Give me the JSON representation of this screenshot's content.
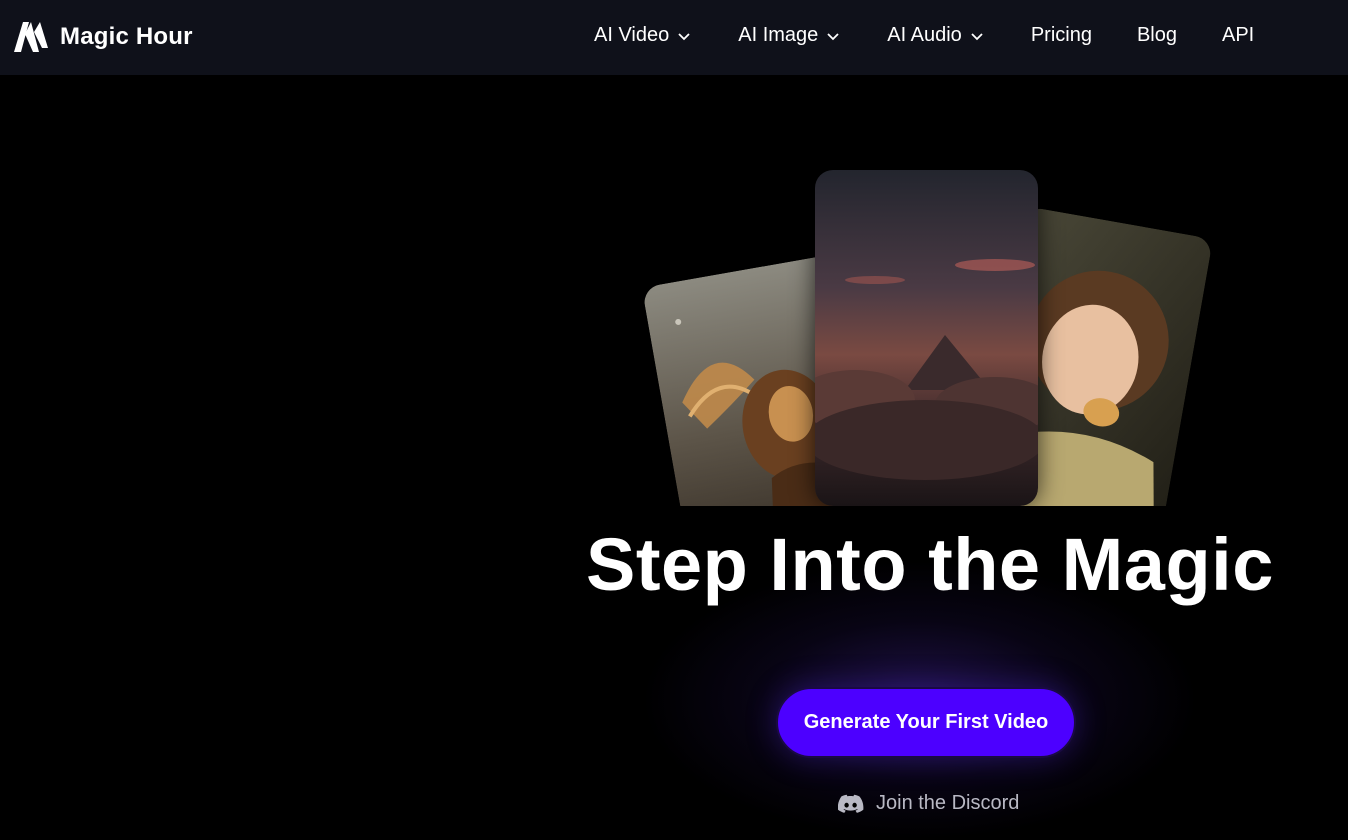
{
  "brand": {
    "name": "Magic Hour",
    "logo_icon": "magic-hour-logo-icon"
  },
  "nav": {
    "items": [
      {
        "label": "AI Video",
        "has_dropdown": true
      },
      {
        "label": "AI Image",
        "has_dropdown": true
      },
      {
        "label": "AI Audio",
        "has_dropdown": true
      },
      {
        "label": "Pricing",
        "has_dropdown": false
      },
      {
        "label": "Blog",
        "has_dropdown": false
      },
      {
        "label": "API",
        "has_dropdown": false
      }
    ]
  },
  "hero": {
    "headline": "Step Into the Magic",
    "cta_label": "Generate Your First Video",
    "discord_label": "Join the Discord",
    "discord_icon": "discord-icon",
    "cards": [
      "winged-lion-image",
      "mountain-clouds-image",
      "child-eating-image"
    ]
  },
  "colors": {
    "header_bg": "#0f111a",
    "page_bg": "#000000",
    "cta_bg": "#4c00ff",
    "text": "#ffffff",
    "muted_text": "#b9b9c4"
  }
}
